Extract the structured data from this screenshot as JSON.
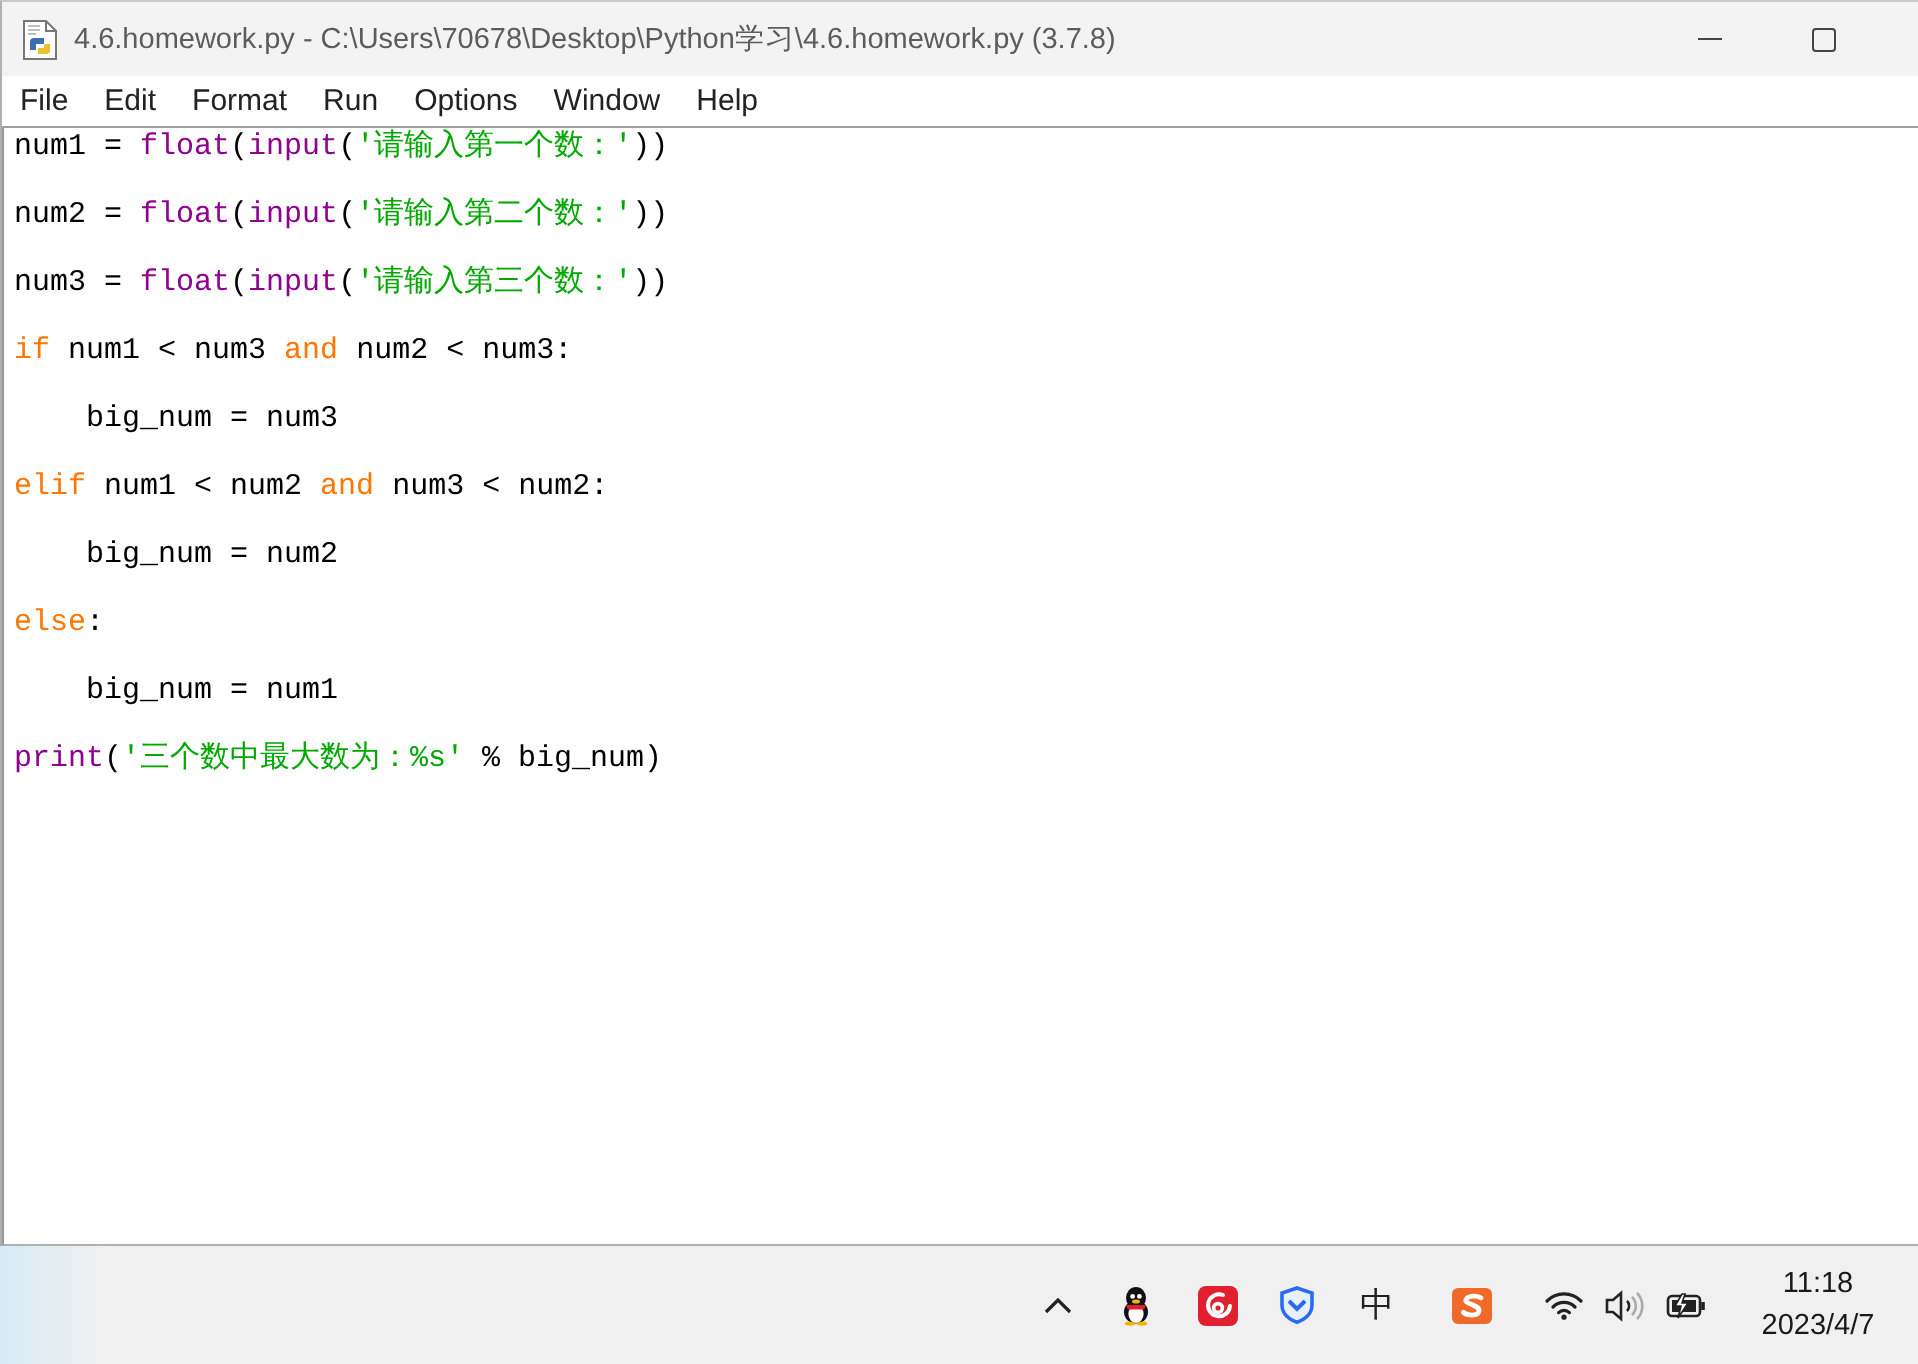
{
  "window": {
    "title": "4.6.homework.py - C:\\Users\\70678\\Desktop\\Python学习\\4.6.homework.py (3.7.8)"
  },
  "menu_bar": [
    {
      "label": "File"
    },
    {
      "label": "Edit"
    },
    {
      "label": "Format"
    },
    {
      "label": "Run"
    },
    {
      "label": "Options"
    },
    {
      "label": "Window"
    },
    {
      "label": "Help"
    }
  ],
  "editor": {
    "lines": [
      {
        "tokens": [
          {
            "kind": "plain",
            "text": "num1 = "
          },
          {
            "kind": "builtin",
            "text": "float"
          },
          {
            "kind": "plain",
            "text": "("
          },
          {
            "kind": "builtin",
            "text": "input"
          },
          {
            "kind": "plain",
            "text": "("
          },
          {
            "kind": "string",
            "text": "'请输入第一个数：'"
          },
          {
            "kind": "plain",
            "text": "))"
          }
        ]
      },
      {
        "tokens": [
          {
            "kind": "plain",
            "text": "num2 = "
          },
          {
            "kind": "builtin",
            "text": "float"
          },
          {
            "kind": "plain",
            "text": "("
          },
          {
            "kind": "builtin",
            "text": "input"
          },
          {
            "kind": "plain",
            "text": "("
          },
          {
            "kind": "string",
            "text": "'请输入第二个数：'"
          },
          {
            "kind": "plain",
            "text": "))"
          }
        ]
      },
      {
        "tokens": [
          {
            "kind": "plain",
            "text": "num3 = "
          },
          {
            "kind": "builtin",
            "text": "float"
          },
          {
            "kind": "plain",
            "text": "("
          },
          {
            "kind": "builtin",
            "text": "input"
          },
          {
            "kind": "plain",
            "text": "("
          },
          {
            "kind": "string",
            "text": "'请输入第三个数：'"
          },
          {
            "kind": "plain",
            "text": "))"
          }
        ]
      },
      {
        "tokens": [
          {
            "kind": "keyword",
            "text": "if"
          },
          {
            "kind": "plain",
            "text": " num1 < num3 "
          },
          {
            "kind": "keyword",
            "text": "and"
          },
          {
            "kind": "plain",
            "text": " num2 < num3:"
          }
        ],
        "children": [
          {
            "tokens": [
              {
                "kind": "plain",
                "text": "big_num = num3"
              }
            ]
          }
        ]
      },
      {
        "tokens": [
          {
            "kind": "keyword",
            "text": "elif"
          },
          {
            "kind": "plain",
            "text": " num1 < num2 "
          },
          {
            "kind": "keyword",
            "text": "and"
          },
          {
            "kind": "plain",
            "text": " num3 < num2:"
          }
        ],
        "children": [
          {
            "tokens": [
              {
                "kind": "plain",
                "text": "big_num = num2"
              }
            ]
          }
        ]
      },
      {
        "tokens": [
          {
            "kind": "keyword",
            "text": "else"
          },
          {
            "kind": "plain",
            "text": ":"
          }
        ],
        "children": [
          {
            "tokens": [
              {
                "kind": "plain",
                "text": "big_num = num1"
              }
            ]
          }
        ]
      },
      {
        "tokens": [
          {
            "kind": "builtin",
            "text": "print"
          },
          {
            "kind": "plain",
            "text": "("
          },
          {
            "kind": "string",
            "text": "'三个数中最大数为：%s'"
          },
          {
            "kind": "plain",
            "text": " % big_num)"
          }
        ]
      }
    ]
  },
  "taskbar": {
    "ime": "中",
    "time": "11:18",
    "date": "2023/4/7"
  }
}
